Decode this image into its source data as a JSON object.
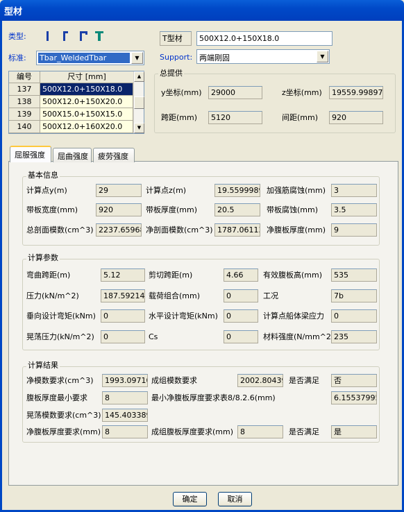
{
  "window": {
    "title": "型材"
  },
  "type_row": {
    "label": "类型:",
    "icons": [
      "l-shape-icon",
      "bracket-shape-icon",
      "angle-shape-icon",
      "t-shape-icon"
    ]
  },
  "profile": {
    "label": "T型材",
    "value": "500X12.0+150X18.0"
  },
  "standard": {
    "label": "标准:",
    "value": "Tbar_WeldedTbar"
  },
  "support": {
    "label": "Support:",
    "value": "两端刚固"
  },
  "table": {
    "headers": [
      "编号",
      "尺寸 [mm]"
    ],
    "rows": [
      {
        "id": "137",
        "size": "500X12.0+150X18.0"
      },
      {
        "id": "138",
        "size": "500X12.0+150X20.0"
      },
      {
        "id": "139",
        "size": "500X15.0+150X15.0"
      },
      {
        "id": "140",
        "size": "500X12.0+160X20.0"
      }
    ]
  },
  "general": {
    "title": "总提供",
    "y_label": "y坐标(mm)",
    "y_value": "29000",
    "z_label": "z坐标(mm)",
    "z_value": "19559.99897",
    "span_label": "跨距(mm)",
    "span_value": "5120",
    "spacing_label": "间距(mm)",
    "spacing_value": "920"
  },
  "tabs": [
    "屈服强度",
    "屈曲强度",
    "疲劳强度"
  ],
  "basic": {
    "title": "基本信息",
    "r1": [
      {
        "label": "计算点y(m)",
        "value": "29"
      },
      {
        "label": "计算点z(m)",
        "value": "19.5599989"
      },
      {
        "label": "加强筋腐蚀(mm)",
        "value": "3"
      }
    ],
    "r2": [
      {
        "label": "带板宽度(mm)",
        "value": "920"
      },
      {
        "label": "带板厚度(mm)",
        "value": "20.5"
      },
      {
        "label": "带板腐蚀(mm)",
        "value": "3.5"
      }
    ],
    "r3": [
      {
        "label": "总剖面模数(cm^3)",
        "value": "2237.65968"
      },
      {
        "label": "净剖面模数(cm^3)",
        "value": "1787.06113"
      },
      {
        "label": "净腹板厚度(mm)",
        "value": "9"
      }
    ]
  },
  "params": {
    "title": "计算参数",
    "r1": [
      {
        "label": "弯曲跨距(m)",
        "value": "5.12"
      },
      {
        "label": "剪切跨距(m)",
        "value": "4.66"
      },
      {
        "label": "有效腹板高(mm)",
        "value": "535"
      }
    ],
    "r2": [
      {
        "label": "压力(kN/m^2)",
        "value": "187.592142"
      },
      {
        "label": "载荷组合(mm)",
        "value": "0"
      },
      {
        "label": "工况",
        "value": "7b"
      }
    ],
    "r3": [
      {
        "label": "垂向设计弯矩(kNm)",
        "value": "0"
      },
      {
        "label": "水平设计弯矩(kNm)",
        "value": "0"
      },
      {
        "label": "计算点船体梁应力",
        "value": "0"
      }
    ],
    "r4": [
      {
        "label": "晃荡压力(kN/m^2)",
        "value": "0"
      },
      {
        "label": "Cs",
        "value": "0"
      },
      {
        "label": "材料强度(N/mm^2)",
        "value": "235"
      }
    ]
  },
  "results": {
    "title": "计算结果",
    "net_mod_label": "净模数要求(cm^3)",
    "net_mod_value": "1993.09710",
    "group_mod_label": "成组模数要求",
    "group_mod_value": "2002.80439",
    "ok1_label": "是否满足",
    "ok1_value": "否",
    "web_min_label": "腹板厚度最小要求",
    "web_min_value": "8",
    "web_table_label": "最小净腹板厚度要求表8/8.2.6(mm)",
    "web_table_value": "6.15537995",
    "slosh_label": "晃荡模数要求(cm^3)",
    "slosh_value": "145.403389",
    "net_web_label": "净腹板厚度要求(mm)",
    "net_web_value": "8",
    "group_web_label": "成组腹板厚度要求(mm)",
    "group_web_value": "8",
    "ok2_label": "是否满足",
    "ok2_value": "是"
  },
  "buttons": {
    "ok": "确定",
    "cancel": "取消"
  }
}
